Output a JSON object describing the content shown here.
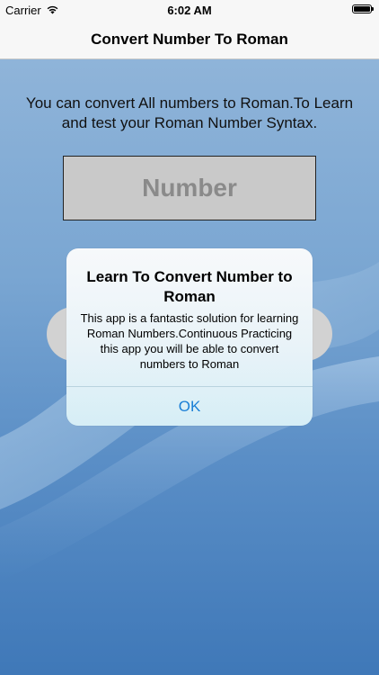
{
  "status_bar": {
    "carrier": "Carrier",
    "time": "6:02 AM",
    "wifi_icon": "wifi-icon",
    "battery_icon": "battery-icon"
  },
  "nav": {
    "title": "Convert Number To Roman"
  },
  "main": {
    "intro_text": "You can convert All numbers to Roman.To Learn and test your Roman Number Syntax.",
    "number_placeholder": "Number"
  },
  "alert": {
    "title": "Learn To Convert Number to Roman",
    "message": "This app is a fantastic solution for learning Roman Numbers.Continuous Practicing this app you will be able to convert numbers to Roman",
    "ok_label": "OK"
  },
  "colors": {
    "accent": "#1a7fd6",
    "nav_background": "#f7f7f7",
    "background_top": "#8fb4d9",
    "background_bottom": "#3f78b8"
  }
}
